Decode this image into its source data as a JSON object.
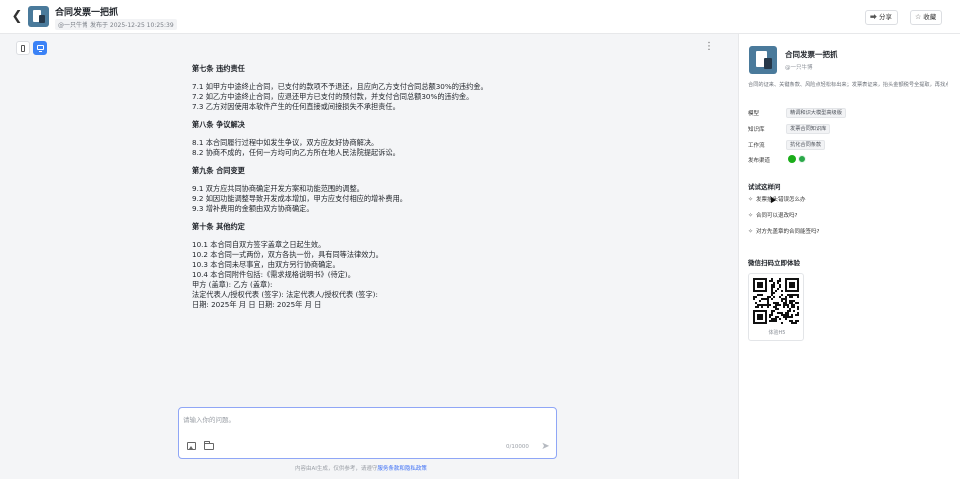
{
  "header": {
    "title": "合同发票一把抓",
    "author": "@一只牛博",
    "date": "发布于 2025-12-25 10:25:39",
    "share_label": "分享",
    "favorite_label": "收藏"
  },
  "document": {
    "sections": [
      {
        "title": "第七条 违约责任",
        "lines": [
          "7.1 如甲方中途终止合同，已支付的款项不予退还，且应向乙方支付合同总额30%的违约金。",
          "7.2 如乙方中途终止合同，应退还甲方已支付的预付款，并支付合同总额30%的违约金。",
          "7.3 乙方对因使用本软件产生的任何直接或间接损失不承担责任。"
        ]
      },
      {
        "title": "第八条 争议解决",
        "lines": [
          "8.1 本合同履行过程中如发生争议，双方应友好协商解决。",
          "8.2 协商不成的，任何一方均可向乙方所在地人民法院提起诉讼。"
        ]
      },
      {
        "title": "第九条 合同变更",
        "lines": [
          "9.1 双方应共同协商确定开发方案和功能范围的调整。",
          "9.2 如因功能调整导致开发成本增加，甲方应支付相应的增补费用。",
          "9.3 增补费用的金额由双方协商确定。"
        ]
      },
      {
        "title": "第十条 其他约定",
        "lines": [
          "10.1 本合同自双方签字盖章之日起生效。",
          "10.2 本合同一式两份，双方各执一份，具有同等法律效力。",
          "10.3 本合同未尽事宜，由双方另行协商确定。",
          "10.4 本合同附件包括:《需求规格说明书》(待定)。",
          "甲方 (盖章):    乙方 (盖章):",
          "法定代表人/授权代表 (签字):   法定代表人/授权代表 (签字):",
          "日期:  2025年 月 日  日期:  2025年 月 日"
        ]
      }
    ]
  },
  "input": {
    "placeholder": "请输入你的问题。",
    "char_count": "0/10000"
  },
  "disclaimer": {
    "text": "内容由AI生成，仅供参考，请遵守",
    "link": "服务条款和隐私政策"
  },
  "side_panel": {
    "title": "合同发票一把抓",
    "author": "@一只牛博",
    "description": "合同的证来、关键条款、风险点轻松标出来；发票表证来，抬头金额税号全提取，再找点一起手，省得你来回切换工具。",
    "meta": [
      {
        "label": "模型",
        "value": "精调和识大模型高级版"
      },
      {
        "label": "知识库",
        "value": "发票合同知识库"
      },
      {
        "label": "工作流",
        "value": "抗化合同条款"
      },
      {
        "label": "发布渠道",
        "value": ""
      }
    ],
    "try_title": "试试这样问",
    "try_items": [
      "发票抬头错误怎么办",
      "合同可以退改吗?",
      "对方先盖章的合同能签吗?"
    ],
    "qr_title": "微信扫码立即体验",
    "qr_caption": "体验H5"
  }
}
